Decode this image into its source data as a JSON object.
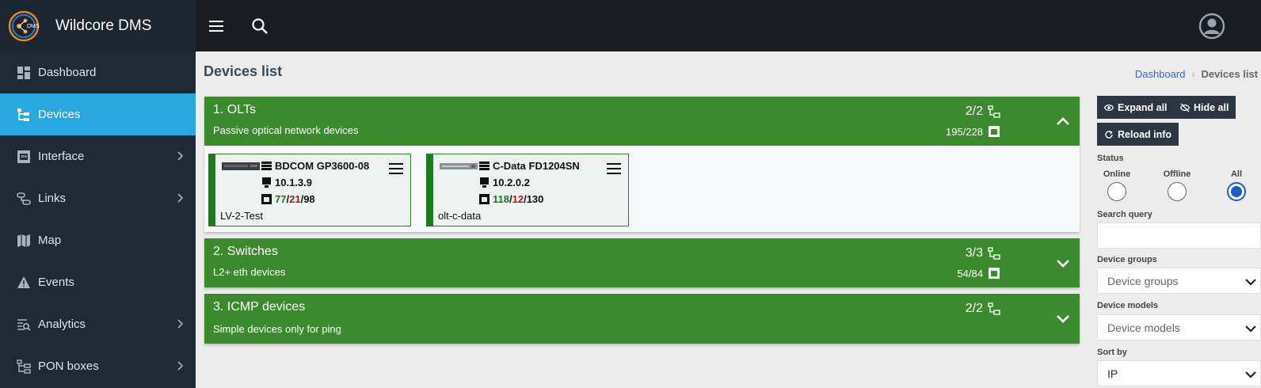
{
  "app": {
    "name": "Wildcore DMS",
    "logo_text": "DMS"
  },
  "sidebar": {
    "items": [
      {
        "label": "Dashboard",
        "icon": "dashboard-icon",
        "active": false,
        "has_children": false
      },
      {
        "label": "Devices",
        "icon": "devices-tree-icon",
        "active": true,
        "has_children": false
      },
      {
        "label": "Interface",
        "icon": "ethernet-port-icon",
        "active": false,
        "has_children": true
      },
      {
        "label": "Links",
        "icon": "links-icon",
        "active": false,
        "has_children": true
      },
      {
        "label": "Map",
        "icon": "map-icon",
        "active": false,
        "has_children": false
      },
      {
        "label": "Events",
        "icon": "warning-icon",
        "active": false,
        "has_children": false
      },
      {
        "label": "Analytics",
        "icon": "analytics-icon",
        "active": false,
        "has_children": true
      },
      {
        "label": "PON boxes",
        "icon": "pon-boxes-icon",
        "active": false,
        "has_children": true
      }
    ]
  },
  "page": {
    "title": "Devices list"
  },
  "breadcrumb": {
    "home": "Dashboard",
    "separator": "›",
    "current": "Devices list"
  },
  "groups": [
    {
      "title": "1. OLTs",
      "description": "Passive optical network devices",
      "device_count": "2/2",
      "port_count": "195/228",
      "expanded": true,
      "devices": [
        {
          "model": "BDCOM GP3600-08",
          "ip": "10.1.3.9",
          "onu_online": "77",
          "onu_offline": "21",
          "onu_total": "98",
          "name": "LV-2-Test"
        },
        {
          "model": "C-Data FD1204SN",
          "ip": "10.2.0.2",
          "onu_online": "118",
          "onu_offline": "12",
          "onu_total": "130",
          "name": "olt-c-data"
        }
      ]
    },
    {
      "title": "2. Switches",
      "description": "L2+ eth devices",
      "device_count": "3/3",
      "port_count": "54/84",
      "expanded": false
    },
    {
      "title": "3. ICMP devices",
      "description": "Simple devices only for ping",
      "device_count": "2/2",
      "port_count": "",
      "expanded": false
    }
  ],
  "controls": {
    "expand_all": "Expand all",
    "hide_all": "Hide all",
    "reload_info": "Reload info",
    "status_label": "Status",
    "status_options": {
      "online": "Online",
      "offline": "Offline",
      "all": "All"
    },
    "status_selected": "All",
    "search_label": "Search query",
    "search_value": "",
    "groups_label": "Device groups",
    "groups_placeholder": "Device groups",
    "models_label": "Device models",
    "models_placeholder": "Device models",
    "sort_label": "Sort by",
    "sort_value": "IP"
  },
  "colors": {
    "sidebar_bg": "#1f2a35",
    "active_item": "#29a7df",
    "group_bg": "#3c8a2e",
    "topbar_bg": "#191c21",
    "radio_selected": "#1b5fc9"
  }
}
